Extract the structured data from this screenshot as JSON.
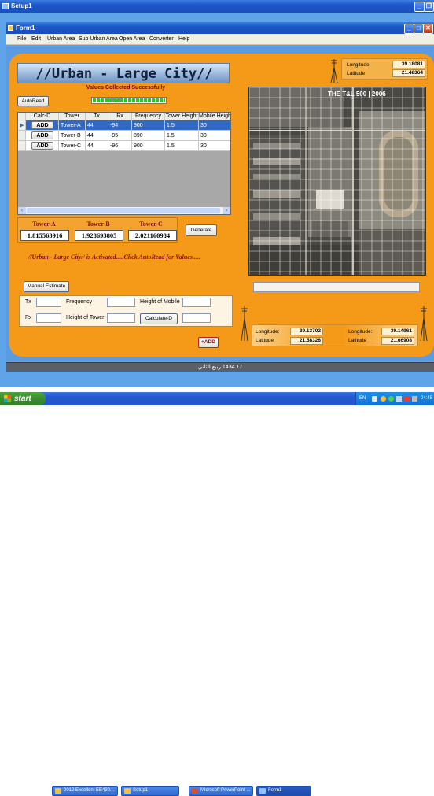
{
  "setup_window": {
    "title": "Setup1"
  },
  "form_window": {
    "title": "Form1"
  },
  "menu": [
    "File",
    "Edit",
    "Urban Area",
    "Sub Urban Area",
    "Open Area",
    "Converter",
    "Help"
  ],
  "banner": {
    "title": "//Urban - Large City//",
    "status": "Values Collected Successfully"
  },
  "autoread_label": "AutoRead",
  "progress": {
    "fraction": 1.0,
    "color": "#22cc22"
  },
  "top_coords": {
    "longitude_label": "Longitude:",
    "longitude_value": "39.18081",
    "latitude_label": "Latitude",
    "latitude_value": "21.48364"
  },
  "grid": {
    "columns": [
      "Calc-D",
      "Tower",
      "Tx",
      "Rx",
      "Frequency",
      "Tower Height",
      "Mobile Height"
    ],
    "rows": [
      {
        "calc": "ADD",
        "tower": "Tower-A",
        "tx": "44",
        "rx": "-94",
        "freq": "900",
        "tower_height": "1.5",
        "mobile_height": "30",
        "selected": true
      },
      {
        "calc": "ADD",
        "tower": "Tower-B",
        "tx": "44",
        "rx": "-95",
        "freq": "890",
        "tower_height": "1.5",
        "mobile_height": "30",
        "selected": false
      },
      {
        "calc": "ADD",
        "tower": "Tower-C",
        "tx": "44",
        "rx": "-96",
        "freq": "900",
        "tower_height": "1.5",
        "mobile_height": "30",
        "selected": false
      }
    ]
  },
  "towers": [
    {
      "label": "Tower-A",
      "value": "1.815563916"
    },
    {
      "label": "Tower-B",
      "value": "1.928693805"
    },
    {
      "label": "Tower-C",
      "value": "2.021160984"
    }
  ],
  "generate_label": "Generate",
  "activation_message": "//Urban - Large City// is Activated.....Click AutoRead for Values.....",
  "map": {
    "watermark": "THE T&L 500 | 2006",
    "grid_color": "#ffffff"
  },
  "manual": {
    "button": "Manual Estimate",
    "tx_label": "Tx",
    "rx_label": "Rx",
    "frequency_label": "Frequency",
    "height_tower_label": "Height of Tower",
    "height_mobile_label": "Height of Mobile",
    "calculate_label": "Calculate-D"
  },
  "bottom_coords": [
    {
      "longitude_label": "Longitude:",
      "longitude_value": "39.13702",
      "latitude_label": "Latitude",
      "latitude_value": "21.58326"
    },
    {
      "longitude_label": "Longitude:",
      "longitude_value": "39.14961",
      "latitude_label": "Latitude",
      "latitude_value": "21.66908"
    }
  ],
  "add_button": "+ADD",
  "status_date": "17 1434 ربيع الثاني",
  "taskbar": {
    "start": "start",
    "items": [
      "2012 Excellent EE420...",
      "Setup1",
      "Microsoft PowerPoint ...",
      "Form1"
    ],
    "lang": "EN",
    "clock": "04:45"
  },
  "colors": {
    "orange": "#f59a18",
    "selection": "#316ac5",
    "xp_blue": "#1d55c8"
  }
}
